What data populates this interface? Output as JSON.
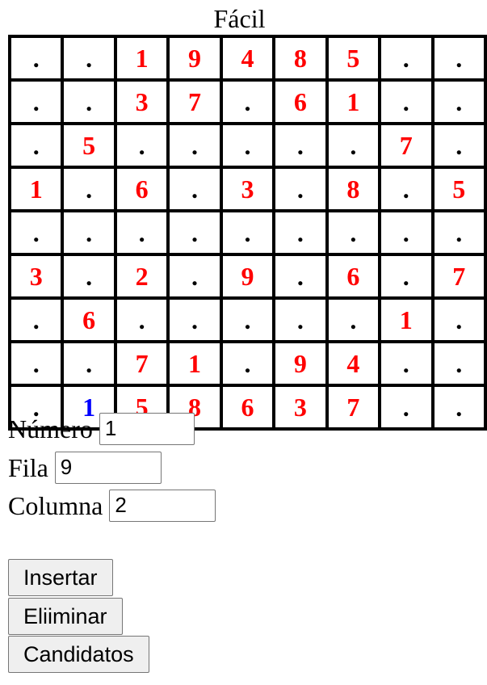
{
  "title": "Fácil",
  "colors": {
    "given": "#ff0000",
    "user": "#0000ff",
    "empty": "#000000",
    "grid": "#000000"
  },
  "board": [
    [
      ".",
      ".",
      "1",
      "9",
      "4",
      "8",
      "5",
      ".",
      "."
    ],
    [
      ".",
      ".",
      "3",
      "7",
      ".",
      "6",
      "1",
      ".",
      "."
    ],
    [
      ".",
      "5",
      ".",
      ".",
      ".",
      ".",
      ".",
      "7",
      "."
    ],
    [
      "1",
      ".",
      "6",
      ".",
      "3",
      ".",
      "8",
      ".",
      "5"
    ],
    [
      ".",
      ".",
      ".",
      ".",
      ".",
      ".",
      ".",
      ".",
      "."
    ],
    [
      "3",
      ".",
      "2",
      ".",
      "9",
      ".",
      "6",
      ".",
      "7"
    ],
    [
      ".",
      "6",
      ".",
      ".",
      ".",
      ".",
      ".",
      "1",
      "."
    ],
    [
      ".",
      ".",
      "7",
      "1",
      ".",
      "9",
      "4",
      ".",
      "."
    ],
    [
      ".",
      "1",
      "5",
      "8",
      "6",
      "3",
      "7",
      ".",
      "."
    ]
  ],
  "user_cells": [
    [
      8,
      1
    ]
  ],
  "form": {
    "numero_label": "Número",
    "numero_value": "1",
    "fila_label": "Fila",
    "fila_value": "9",
    "columna_label": "Columna",
    "columna_value": "2"
  },
  "buttons": {
    "insertar": "Insertar",
    "eliminar": "Eliiminar",
    "candidatos": "Candidatos"
  }
}
